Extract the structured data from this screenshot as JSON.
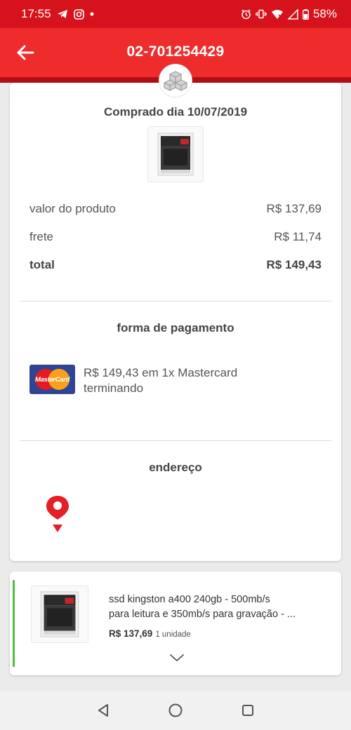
{
  "status_bar": {
    "time": "17:55",
    "battery": "58%"
  },
  "app_bar": {
    "title": "02-701254429"
  },
  "order": {
    "purchase_date": "Comprado dia 10/07/2019",
    "product_value_label": "valor do produto",
    "product_value": "R$ 137,69",
    "shipping_label": "frete",
    "shipping_value": "R$ 11,74",
    "total_label": "total",
    "total_value": "R$ 149,43"
  },
  "payment": {
    "section_title": "forma de pagamento",
    "card_brand_logo": "MasterCard",
    "description_line1": "R$ 149,43 em 1x Mastercard",
    "description_line2": "terminando"
  },
  "address": {
    "section_title": "endereço"
  },
  "item": {
    "name_line1": "ssd kingston a400 240gb - 500mb/s",
    "name_line2": "para leitura e 350mb/s para gravação - ...",
    "price": "R$ 137,69",
    "quantity": "1 unidade"
  },
  "colors": {
    "brand_red": "#ee2c2c",
    "status_red": "#d6131c",
    "green_accent": "#4cc03f",
    "mastercard_blue": "#2f4493"
  },
  "icons": [
    "telegram-icon",
    "instagram-icon",
    "alarm-icon",
    "vibrate-icon",
    "wifi-icon",
    "signal-icon",
    "battery-icon",
    "back-arrow-icon",
    "boxes-icon",
    "map-pin-icon",
    "chevron-down-icon",
    "nav-back-icon",
    "nav-home-icon",
    "nav-recents-icon"
  ]
}
